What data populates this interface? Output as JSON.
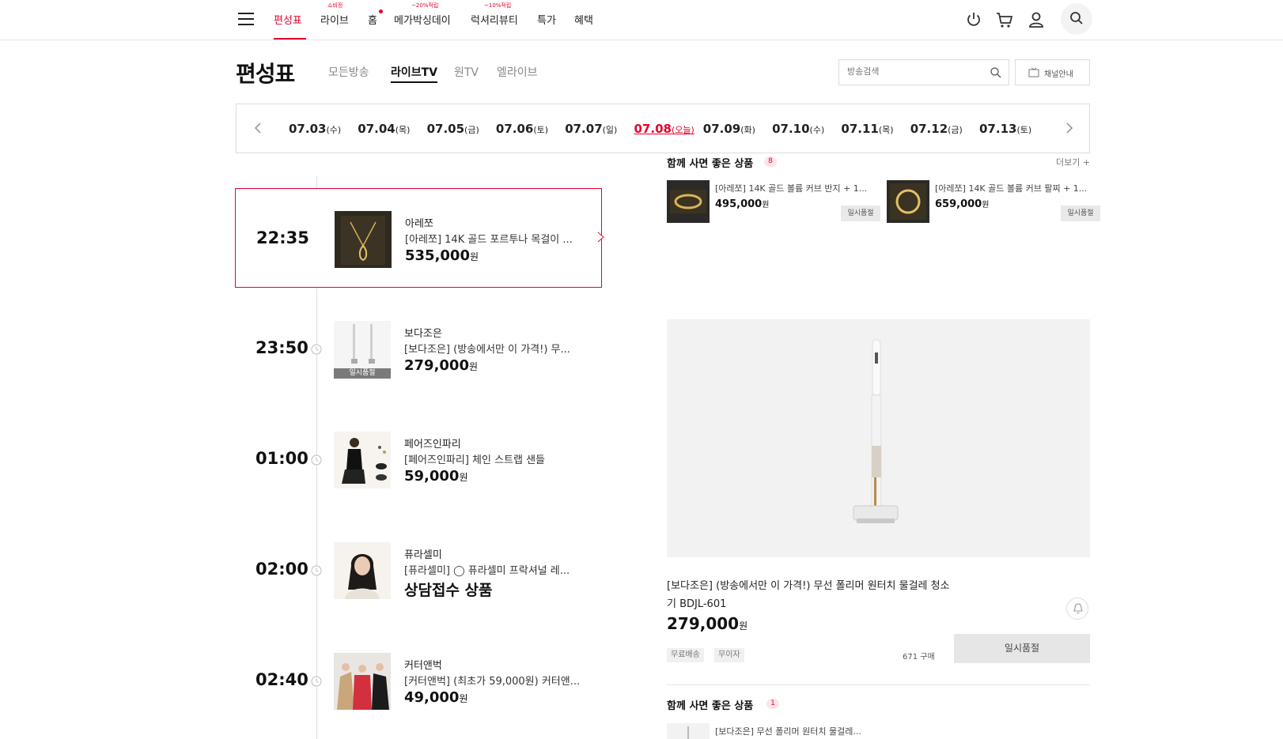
{
  "nav": {
    "items": [
      {
        "label": "편성표",
        "badge": ""
      },
      {
        "label": "라이브",
        "badge": "쇼비정"
      },
      {
        "label": "홈",
        "badge": ""
      },
      {
        "label": "메가박싱데이",
        "badge": "~20%적립"
      },
      {
        "label": "럭셔리뷰티",
        "badge": "~10%적립"
      },
      {
        "label": "특가",
        "badge": ""
      },
      {
        "label": "혜택",
        "badge": ""
      }
    ],
    "active_index": 0,
    "accent_color": "#e8002d"
  },
  "page": {
    "title": "편성표",
    "sub_tabs": [
      "모든방송",
      "라이브TV",
      "원TV",
      "엘라이브"
    ],
    "active_sub_tab": 1,
    "search_placeholder": "방송검색",
    "channel_guide": "채널안내"
  },
  "dates": [
    {
      "date": "07.03",
      "day": "(수)"
    },
    {
      "date": "07.04",
      "day": "(목)"
    },
    {
      "date": "07.05",
      "day": "(금)"
    },
    {
      "date": "07.06",
      "day": "(토)"
    },
    {
      "date": "07.07",
      "day": "(일)"
    },
    {
      "date": "07.08",
      "day": "(오늘)"
    },
    {
      "date": "07.09",
      "day": "(화)"
    },
    {
      "date": "07.10",
      "day": "(수)"
    },
    {
      "date": "07.11",
      "day": "(목)"
    },
    {
      "date": "07.12",
      "day": "(금)"
    },
    {
      "date": "07.13",
      "day": "(토)"
    }
  ],
  "schedule": [
    {
      "time": "22:35",
      "brand": "아레쪼",
      "name": "[아레쪼] 14K 골드 포르투나 목걸이 ...",
      "price": "535,000",
      "unit": "원",
      "sold_out": "",
      "consult": ""
    },
    {
      "time": "23:50",
      "brand": "보다조은",
      "name": "[보다조은] (방송에서만 이 가격!) 무...",
      "price": "279,000",
      "unit": "원",
      "sold_out": "일시품절",
      "consult": ""
    },
    {
      "time": "01:00",
      "brand": "페어즈인파리",
      "name": "[페어즈인파리] 체인 스트랩 샌들",
      "price": "59,000",
      "unit": "원",
      "sold_out": "",
      "consult": ""
    },
    {
      "time": "02:00",
      "brand": "퓨라셀미",
      "name": "[퓨라셀미] ◯ 퓨라셀미 프락셔널 레...",
      "price": "",
      "unit": "",
      "sold_out": "",
      "consult": "상담접수 상품"
    },
    {
      "time": "02:40",
      "brand": "커터앤벅",
      "name": "[커터앤벅] (최초가 59,000원) 커터앤...",
      "price": "49,000",
      "unit": "원",
      "sold_out": "",
      "consult": ""
    }
  ],
  "together": {
    "title": "함께 사면 좋은 상품",
    "count": "8",
    "more": "더보기 +",
    "items": [
      {
        "name": "[아레쪼] 14K 골드 볼륨 커브 반지 + 1...",
        "price": "495,000",
        "unit": "원",
        "status": "일시품절"
      },
      {
        "name": "[아레쪼] 14K 골드 볼륨 커브 팔찌 + 1...",
        "price": "659,000",
        "unit": "원",
        "status": "일시품절"
      }
    ]
  },
  "featured": {
    "name": "[보다조은] (방송에서만 이 가격!) 무선 폴리머 원터치 물걸레 청소기 BDJL-601",
    "price": "279,000",
    "unit": "원",
    "tags": [
      "무료배송",
      "무이자"
    ],
    "buy_count": "671 구매",
    "status": "일시품절"
  },
  "together2": {
    "title": "함께 사면 좋은 상품",
    "count": "1",
    "item_name": "[보다조은] 무선 폴리머 원터치 물걸레..."
  }
}
